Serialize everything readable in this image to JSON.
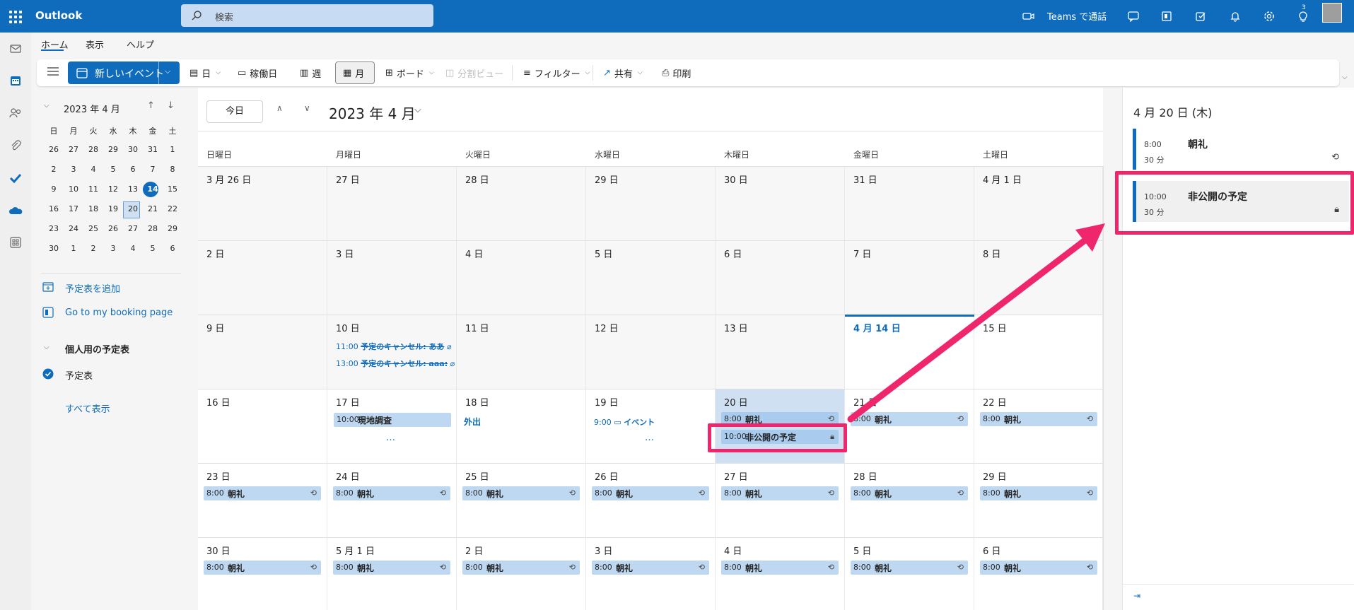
{
  "app": {
    "name": "Outlook",
    "search_placeholder": "検索",
    "teams_label": "Teams で通話",
    "badge": "3"
  },
  "ribbon": {
    "tabs": [
      "ホーム",
      "表示",
      "ヘルプ"
    ],
    "toolbar": {
      "new_event": "新しいイベント",
      "day": "日",
      "workweek": "稼働日",
      "week": "週",
      "month": "月",
      "board": "ボード",
      "split": "分割ビュー",
      "filter": "フィルター",
      "share": "共有",
      "print": "印刷"
    }
  },
  "minical": {
    "title": "2023 年 4 月",
    "weekdays": [
      "日",
      "月",
      "火",
      "水",
      "木",
      "金",
      "土"
    ],
    "weeks": [
      [
        "26",
        "27",
        "28",
        "29",
        "30",
        "31",
        "1"
      ],
      [
        "2",
        "3",
        "4",
        "5",
        "6",
        "7",
        "8"
      ],
      [
        "9",
        "10",
        "11",
        "12",
        "13",
        "14",
        "15"
      ],
      [
        "16",
        "17",
        "18",
        "19",
        "20",
        "21",
        "22"
      ],
      [
        "23",
        "24",
        "25",
        "26",
        "27",
        "28",
        "29"
      ],
      [
        "30",
        "1",
        "2",
        "3",
        "4",
        "5",
        "6"
      ]
    ]
  },
  "sidebar": {
    "add_calendar": "予定表を追加",
    "booking": "Go to my booking page",
    "group": "個人用の予定表",
    "calendar": "予定表",
    "show_all": "すべて表示"
  },
  "calendar": {
    "today_button": "今日",
    "title": "2023 年 4 月",
    "day_names": [
      "日曜日",
      "月曜日",
      "火曜日",
      "水曜日",
      "木曜日",
      "金曜日",
      "土曜日"
    ],
    "weeks": [
      [
        "3 月 26 日",
        "27 日",
        "28 日",
        "29 日",
        "30 日",
        "31 日",
        "4 月 1 日"
      ],
      [
        "2 日",
        "3 日",
        "4 日",
        "5 日",
        "6 日",
        "7 日",
        "8 日"
      ],
      [
        "9 日",
        "10 日",
        "11 日",
        "12 日",
        "13 日",
        "4 月 14 日",
        "15 日"
      ],
      [
        "16 日",
        "17 日",
        "18 日",
        "19 日",
        "20 日",
        "21 日",
        "22 日"
      ],
      [
        "23 日",
        "24 日",
        "25 日",
        "26 日",
        "27 日",
        "28 日",
        "29 日"
      ],
      [
        "30 日",
        "5 月 1 日",
        "2 日",
        "3 日",
        "4 日",
        "5 日",
        "6 日"
      ]
    ],
    "events": {
      "cancel1_time": "11:00",
      "cancel1_name": "予定のキャンセル: ああ",
      "cancel2_time": "13:00",
      "cancel2_name": "予定のキャンセル: aaa:",
      "site_time": "10:00",
      "site_name": "現地調査",
      "allday_name": "外出",
      "event19_time": "9:00",
      "event19_name": "イベント",
      "more": "…",
      "morning_time": "8:00",
      "morning_name": "朝礼",
      "private_time": "10:00",
      "private_name": "非公開の予定"
    }
  },
  "pane": {
    "title": "4 月 20 日 (木)",
    "items": [
      {
        "time": "8:00",
        "duration": "30 分",
        "title": "朝礼"
      },
      {
        "time": "10:00",
        "duration": "30 分",
        "title": "非公開の予定"
      }
    ]
  },
  "colors": {
    "brand": "#0f6cbd",
    "highlight": "#f0266d",
    "event_bg": "#bfd8f2"
  }
}
